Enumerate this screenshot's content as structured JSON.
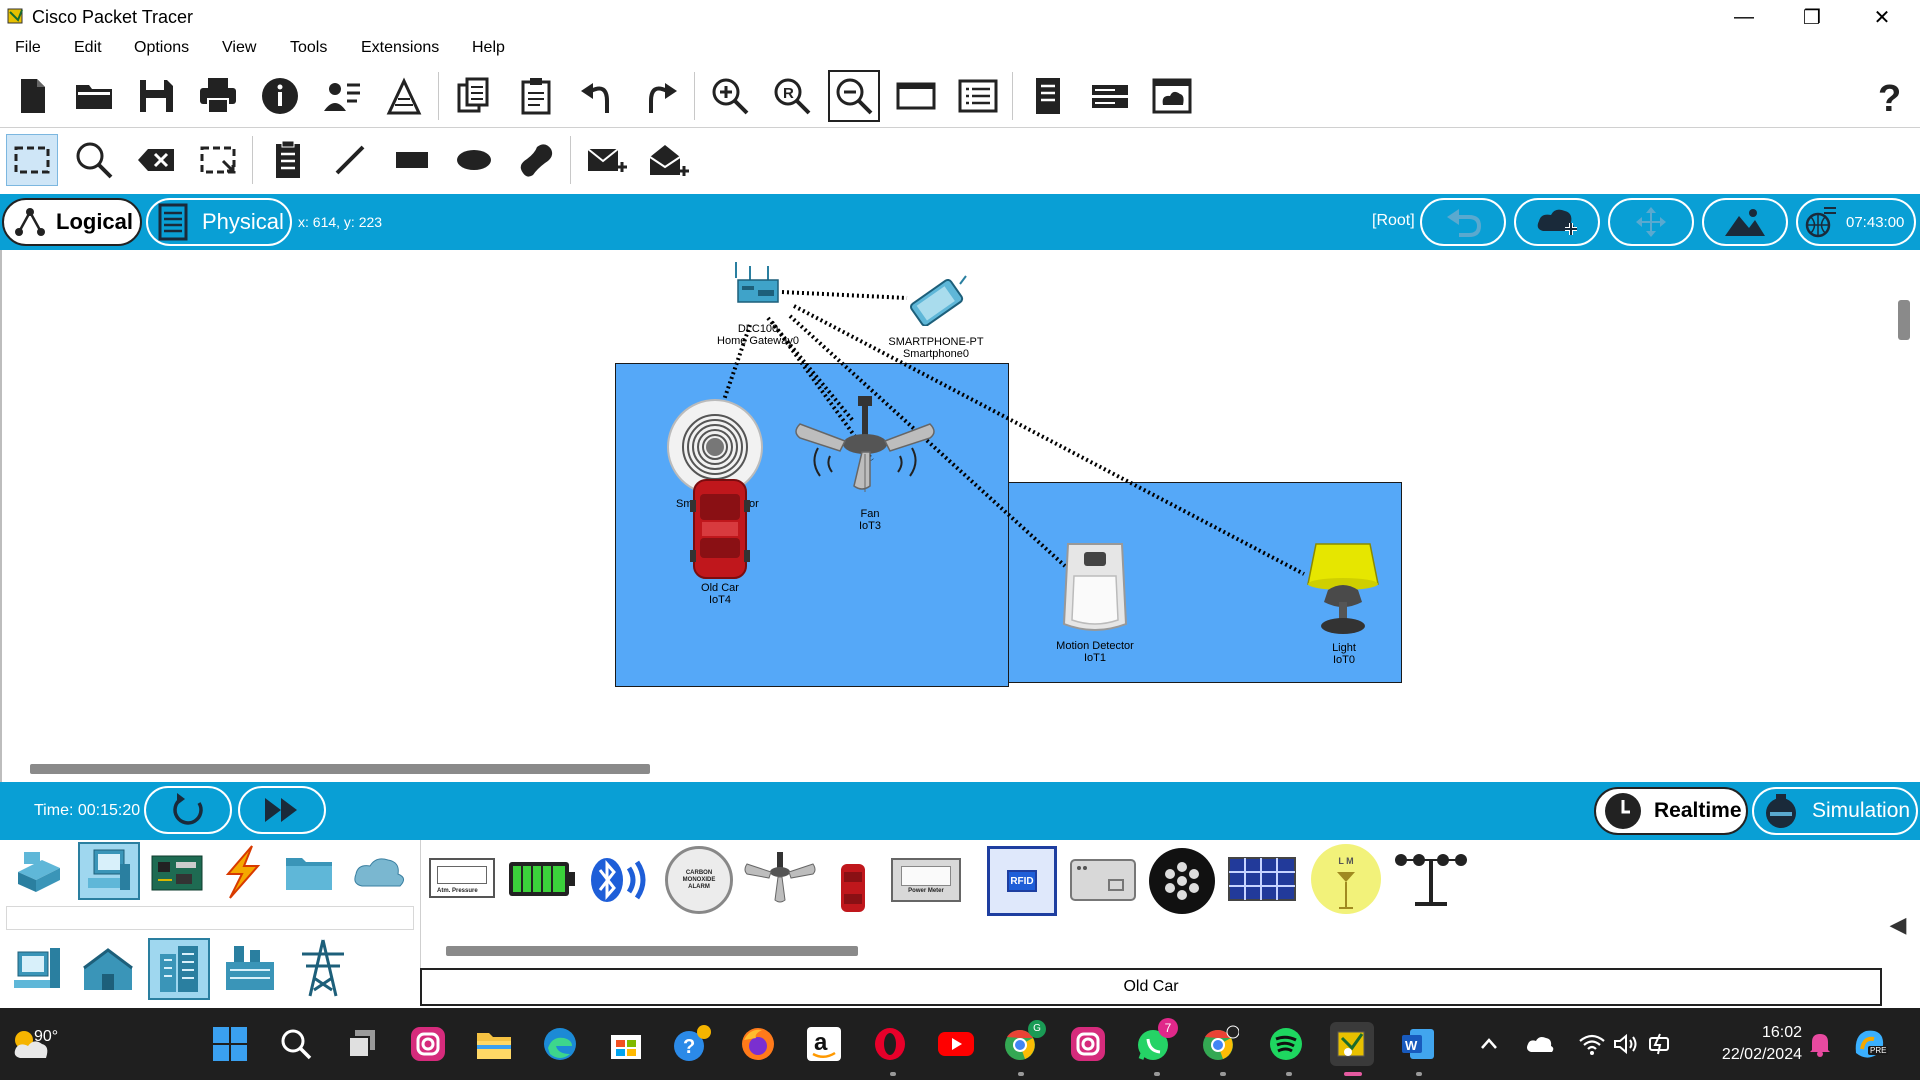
{
  "window": {
    "title": "Cisco Packet Tracer"
  },
  "menu": [
    "File",
    "Edit",
    "Options",
    "View",
    "Tools",
    "Extensions",
    "Help"
  ],
  "modes": {
    "logical": "Logical",
    "physical": "Physical"
  },
  "cursor_coords": "x: 614, y: 223",
  "workspace": {
    "root_label": "[Root]",
    "clock": "07:43:00"
  },
  "devices": {
    "gateway": {
      "line1": "DLC100",
      "line2": "Home Gateway0"
    },
    "smartphone": {
      "line1": "SMARTPHONE-PT",
      "line2": "Smartphone0"
    },
    "smoke": {
      "line1": "Sm",
      "line2": "or"
    },
    "fan": {
      "line1": "Fan",
      "line2": "IoT3"
    },
    "car": {
      "line1": "Old Car",
      "line2": "IoT4"
    },
    "motion": {
      "line1": "Motion Detector",
      "line2": "IoT1"
    },
    "light": {
      "line1": "Light",
      "line2": "IoT0"
    }
  },
  "sim": {
    "time": "Time: 00:15:20",
    "realtime": "Realtime",
    "simulation": "Simulation"
  },
  "palette": {
    "selected_device": "Old Car",
    "atm_pressure_label": "Atm. Pressure",
    "co_alarm_label": "CARBON MONOXIDE ALARM",
    "power_meter_label": "Power Meter",
    "rfid_label": "RFID",
    "lm_label": "L M"
  },
  "taskbar": {
    "weather": "90°",
    "time": "16:02",
    "date": "22/02/2024",
    "whatsapp_badge": "7",
    "chrome_badge": "G",
    "copilot_badge": "PRE"
  },
  "colors": {
    "accent_blue": "#099fd5",
    "cluster_blue": "#55a8f8",
    "taskbar": "#1f1f1f"
  }
}
